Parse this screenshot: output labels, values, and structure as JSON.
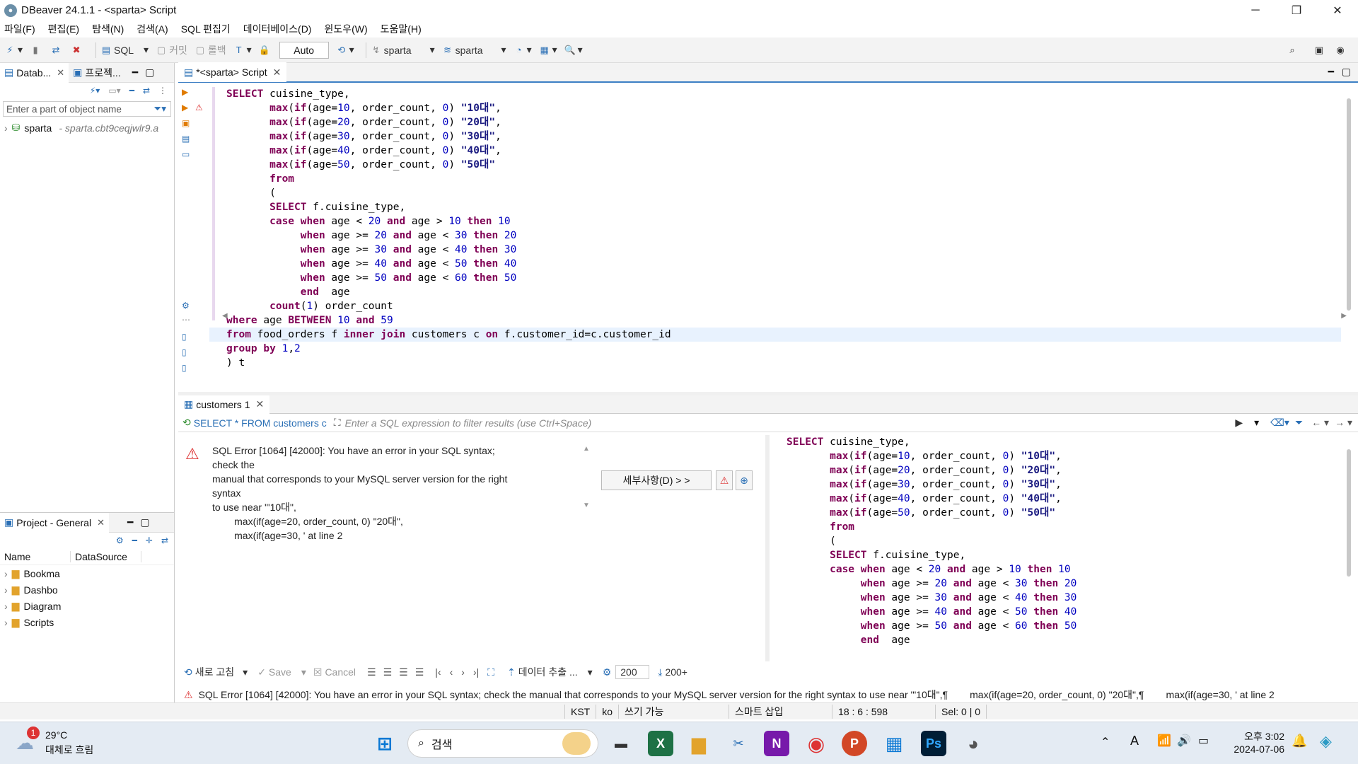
{
  "window": {
    "title": "DBeaver 24.1.1 - <sparta> Script",
    "minimize": "─",
    "maximize": "❐",
    "close": "✕"
  },
  "menu": [
    "파일(F)",
    "편집(E)",
    "탐색(N)",
    "검색(A)",
    "SQL 편집기",
    "데이터베이스(D)",
    "윈도우(W)",
    "도움말(H)"
  ],
  "toolbar": {
    "sql_label": "SQL",
    "commit": "커밋",
    "rollback": "롤백",
    "auto": "Auto",
    "datasource": "sparta",
    "schema": "sparta"
  },
  "left": {
    "tab_db": "Datab...",
    "tab_proj": "프로젝...",
    "search_placeholder": "Enter a part of object name",
    "tree_item": "sparta",
    "tree_item_host": "- sparta.cbt9ceqjwlr9.a",
    "project_tab": "Project - General",
    "col_name": "Name",
    "col_datasource": "DataSource",
    "items": [
      "Bookma",
      "Dashbo",
      "Diagram",
      "Scripts"
    ]
  },
  "editor": {
    "tab_label": "*<sparta> Script"
  },
  "results": {
    "tab_label": "customers 1",
    "query_preview": "SELECT * FROM customers c",
    "filter_placeholder": "Enter a SQL expression to filter results (use Ctrl+Space)",
    "error_lines": [
      "SQL Error [1064] [42000]: You have an error in your SQL syntax; check the",
      "manual that corresponds to your MySQL server version for the right syntax",
      "to use near '\"10대\",",
      "        max(if(age=20, order_count, 0) \"20대\",",
      "        max(if(age=30, ' at line 2"
    ],
    "details_button": "세부사항(D) > >"
  },
  "bottom_toolbar": {
    "refresh": "새로 고침",
    "save": "Save",
    "cancel": "Cancel",
    "export": "데이터 추출 ...",
    "fetch_size": "200",
    "fetch_count": "200+"
  },
  "status_message": "SQL Error [1064] [42000]: You have an error in your SQL syntax; check the manual that corresponds to your MySQL server version for the right syntax to use near '\"10대\",¶        max(if(age=20, order_count, 0) \"20대\",¶        max(if(age=30, ' at line 2",
  "statusbar": {
    "tz": "KST",
    "lang": "ko",
    "mode": "쓰기 가능",
    "insert": "스마트 삽입",
    "pos": "18 : 6 : 598",
    "sel": "Sel: 0 | 0"
  },
  "taskbar": {
    "weather_temp": "29°C",
    "weather_desc": "대체로 흐림",
    "weather_badge": "1",
    "search": "검색",
    "time": "오후 3:02",
    "date": "2024-07-06"
  }
}
